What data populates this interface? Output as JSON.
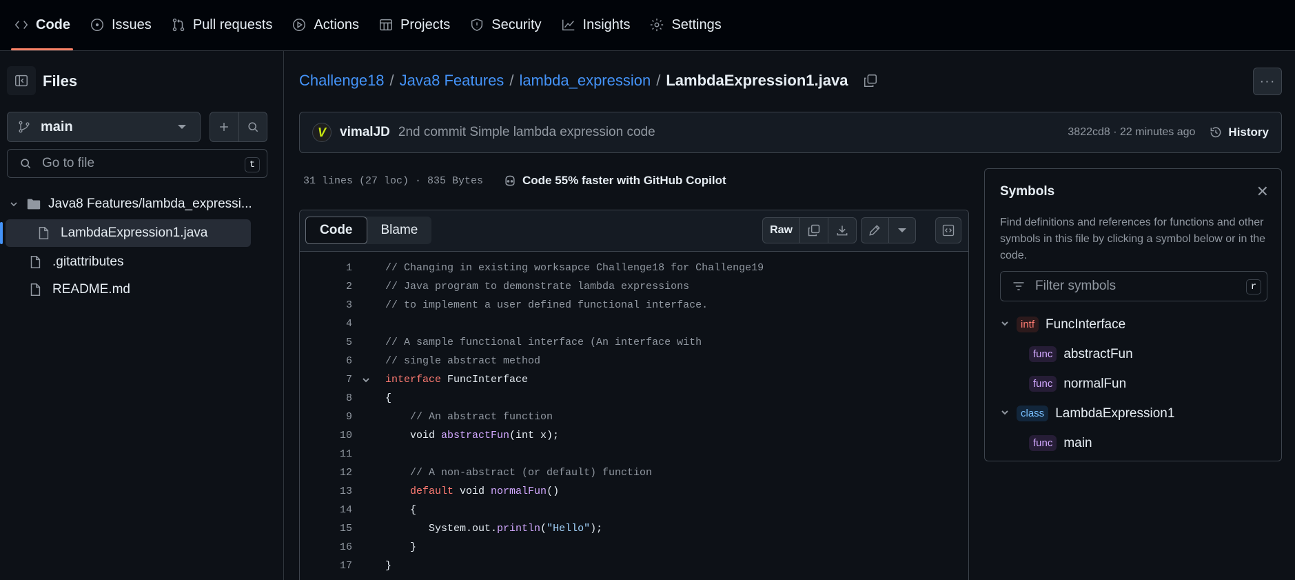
{
  "nav": {
    "tabs": [
      {
        "label": "Code"
      },
      {
        "label": "Issues"
      },
      {
        "label": "Pull requests"
      },
      {
        "label": "Actions"
      },
      {
        "label": "Projects"
      },
      {
        "label": "Security"
      },
      {
        "label": "Insights"
      },
      {
        "label": "Settings"
      }
    ]
  },
  "sidebar": {
    "title": "Files",
    "branch": "main",
    "goto_placeholder": "Go to file",
    "goto_shortcut": "t",
    "tree": [
      {
        "label": "Java8 Features/lambda_expressi..."
      },
      {
        "label": "LambdaExpression1.java"
      },
      {
        "label": ".gitattributes"
      },
      {
        "label": "README.md"
      }
    ]
  },
  "breadcrumb": {
    "parts": [
      "Challenge18",
      "Java8 Features",
      "lambda_expression"
    ],
    "separator": "/",
    "current": "LambdaExpression1.java"
  },
  "commit": {
    "avatar_letter": "V",
    "author": "vimalJD",
    "message": "2nd commit Simple lambda expression code",
    "meta": "3822cd8 · 22 minutes ago",
    "history_label": "History"
  },
  "file": {
    "info": "31 lines (27 loc) · 835 Bytes",
    "copilot": "Code 55% faster with GitHub Copilot",
    "view_tabs": [
      "Code",
      "Blame"
    ],
    "raw_label": "Raw"
  },
  "code": {
    "lines": [
      {
        "n": "1",
        "segments": [
          {
            "t": "// Changing in existing worksapce Challenge18 for Challenge19",
            "c": "com"
          }
        ]
      },
      {
        "n": "2",
        "segments": [
          {
            "t": "// Java program to demonstrate lambda expressions",
            "c": "com"
          }
        ]
      },
      {
        "n": "3",
        "segments": [
          {
            "t": "// to implement a user defined functional interface.",
            "c": "com"
          }
        ]
      },
      {
        "n": "4",
        "segments": []
      },
      {
        "n": "5",
        "segments": [
          {
            "t": "// A sample functional interface (An interface with",
            "c": "com"
          }
        ]
      },
      {
        "n": "6",
        "segments": [
          {
            "t": "// single abstract method",
            "c": "com"
          }
        ]
      },
      {
        "n": "7",
        "fold": true,
        "segments": [
          {
            "t": "interface",
            "c": "kw"
          },
          {
            "t": " FuncInterface",
            "c": ""
          }
        ]
      },
      {
        "n": "8",
        "segments": [
          {
            "t": "{",
            "c": ""
          }
        ]
      },
      {
        "n": "9",
        "segments": [
          {
            "t": "    // An abstract function",
            "c": "com"
          }
        ]
      },
      {
        "n": "10",
        "segments": [
          {
            "t": "    void ",
            "c": ""
          },
          {
            "t": "abstractFun",
            "c": "fn"
          },
          {
            "t": "(int x);",
            "c": ""
          }
        ]
      },
      {
        "n": "11",
        "segments": []
      },
      {
        "n": "12",
        "segments": [
          {
            "t": "    // A non-abstract (or default) function",
            "c": "com"
          }
        ]
      },
      {
        "n": "13",
        "segments": [
          {
            "t": "    ",
            "c": ""
          },
          {
            "t": "default",
            "c": "kw"
          },
          {
            "t": " void ",
            "c": ""
          },
          {
            "t": "normalFun",
            "c": "fn"
          },
          {
            "t": "()",
            "c": ""
          }
        ]
      },
      {
        "n": "14",
        "segments": [
          {
            "t": "    {",
            "c": ""
          }
        ]
      },
      {
        "n": "15",
        "segments": [
          {
            "t": "       System.out.",
            "c": ""
          },
          {
            "t": "println",
            "c": "fn"
          },
          {
            "t": "(",
            "c": ""
          },
          {
            "t": "\"Hello\"",
            "c": "str"
          },
          {
            "t": ");",
            "c": ""
          }
        ]
      },
      {
        "n": "16",
        "segments": [
          {
            "t": "    }",
            "c": ""
          }
        ]
      },
      {
        "n": "17",
        "segments": [
          {
            "t": "}",
            "c": ""
          }
        ]
      }
    ]
  },
  "symbols": {
    "title": "Symbols",
    "description": "Find definitions and references for functions and other symbols in this file by clicking a symbol below or in the code.",
    "filter_placeholder": "Filter symbols",
    "filter_shortcut": "r",
    "items": [
      {
        "kind": "intf",
        "name": "FuncInterface",
        "child": false
      },
      {
        "kind": "func",
        "name": "abstractFun",
        "child": true
      },
      {
        "kind": "func",
        "name": "normalFun",
        "child": true
      },
      {
        "kind": "class",
        "name": "LambdaExpression1",
        "child": false
      },
      {
        "kind": "func",
        "name": "main",
        "child": true
      }
    ]
  },
  "colors": {
    "accent_blue": "#4493f8",
    "active_tab_underline": "#f78166",
    "background": "#0d1117"
  }
}
